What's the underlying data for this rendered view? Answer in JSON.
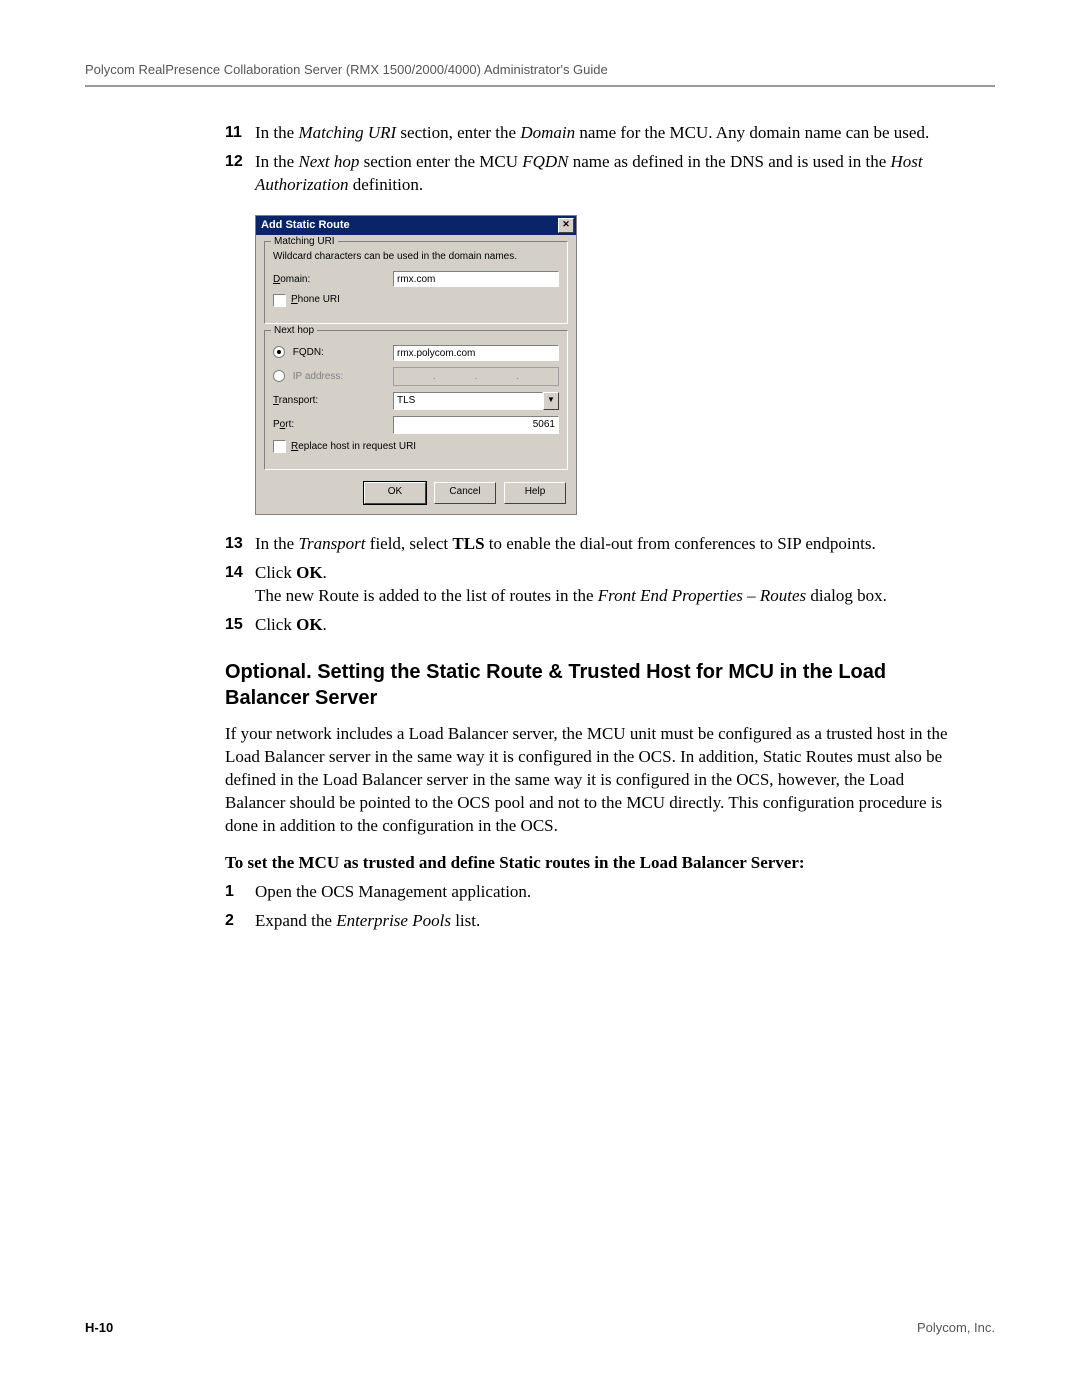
{
  "header": "Polycom RealPresence Collaboration Server (RMX 1500/2000/4000) Administrator's Guide",
  "steps_a": {
    "s11": {
      "num": "11",
      "pre": "In the ",
      "i1": "Matching URI",
      "mid": " section, enter the ",
      "i2": "Domain",
      "post": " name for the MCU. Any domain name can be used."
    },
    "s12": {
      "num": "12",
      "pre": "In the ",
      "i1": "Next hop",
      "mid": " section enter the MCU ",
      "i2": "FQDN",
      "post1": " name as defined in the DNS and is used in the ",
      "i3": "Host Authorization",
      "post2": " definition."
    }
  },
  "dialog": {
    "title": "Add Static Route",
    "matching_group": "Matching URI",
    "wildcard_note": "Wildcard characters can be used in the domain names.",
    "domain_label": "Domain:",
    "domain_value": "rmx.com",
    "phone_uri": "Phone URI",
    "next_hop_group": "Next hop",
    "fqdn_label": "FQDN:",
    "fqdn_value": "rmx.polycom.com",
    "ip_label": "IP address:",
    "transport_label": "Transport:",
    "transport_value": "TLS",
    "port_label": "Port:",
    "port_value": "5061",
    "replace_label": "Replace host in request URI",
    "ok": "OK",
    "cancel": "Cancel",
    "help": "Help"
  },
  "steps_b": {
    "s13": {
      "num": "13",
      "pre": "In the ",
      "i1": "Transport",
      "mid": " field, select ",
      "b1": "TLS",
      "post": " to enable the dial-out from conferences to SIP endpoints."
    },
    "s14": {
      "num": "14",
      "line1a": "Click ",
      "line1b": "OK",
      "line1c": ".",
      "line2a": "The new Route is added to the list of routes in the ",
      "i1": "Front End Properties – Routes",
      "line2b": " dialog box."
    },
    "s15": {
      "num": "15",
      "a": "Click ",
      "b": "OK",
      "c": "."
    }
  },
  "section_heading": "Optional. Setting the Static Route & Trusted Host for MCU in the Load Balancer Server",
  "para1": "If your network includes a Load Balancer server, the MCU unit must be configured as a trusted host in the Load Balancer server in the same way it is configured in the OCS. In addition, Static Routes must also be defined in the Load Balancer server in the same way it is configured in the OCS, however, the Load Balancer should be pointed to the OCS pool and not to the MCU directly. This configuration procedure is done in addition to the configuration in the OCS.",
  "subhead": "To set the MCU as trusted and define Static routes in the Load Balancer Server:",
  "steps_c": {
    "s1": {
      "num": "1",
      "text": "Open the OCS Management application."
    },
    "s2": {
      "num": "2",
      "a": "Expand the ",
      "i1": "Enterprise Pools",
      "b": " list."
    }
  },
  "footer": {
    "page": "H-10",
    "company": "Polycom, Inc."
  }
}
